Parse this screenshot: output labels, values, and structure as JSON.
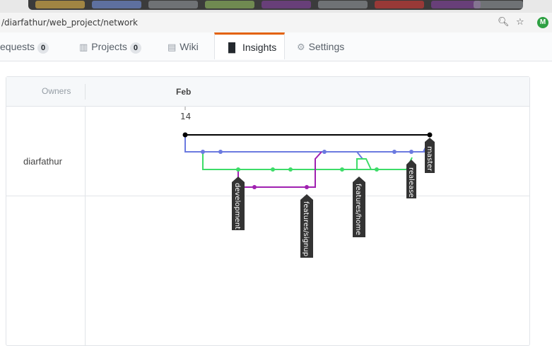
{
  "browser": {
    "url": "/diarfathur/web_project/network",
    "zoom_icon": "zoom-icon",
    "star_icon": "star-icon",
    "avatar_letter": "M",
    "tab_colors": [
      "#f6c24a",
      "#7c9cf2",
      "#2ea043",
      "#9ccc65",
      "#8e44ad",
      "#ffffff",
      "#e53935",
      "#8e44ad",
      "#ffffff"
    ]
  },
  "repo_nav": {
    "pull_requests": {
      "label": "equests",
      "count": "0"
    },
    "projects": {
      "label": "Projects",
      "count": "0",
      "icon": "project-icon"
    },
    "wiki": {
      "label": "Wiki",
      "icon": "book-icon"
    },
    "insights": {
      "label": "Insights",
      "icon": "graph-icon"
    },
    "settings": {
      "label": "Settings",
      "icon": "gear-icon"
    }
  },
  "network": {
    "owners_header": "Owners",
    "month": "Feb",
    "day": "14",
    "owner": "diarfathur",
    "branches": [
      "master",
      "realease",
      "development",
      "features/signup",
      "features/home"
    ],
    "colors": {
      "master": "#000000",
      "blue": "#6b7ae0",
      "green": "#3ddc68",
      "purple": "#a020b0",
      "label_bg": "#333333"
    }
  }
}
